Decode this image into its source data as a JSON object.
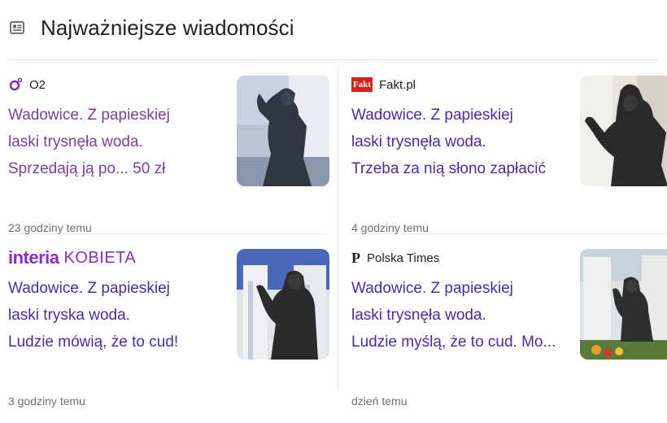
{
  "header": {
    "title": "Najważniejsze wiadomości",
    "icon": "news-icon"
  },
  "colors": {
    "title_link": "#4b2aa8",
    "title_visited": "#7a3fa0",
    "time": "#6f6f6f",
    "interia": "#8a2fc4",
    "fakt": "#d9211c"
  },
  "cards": [
    {
      "source": "O2",
      "source_icon": "o2-logo-icon",
      "title_lines": [
        "Wadowice. Z papieskiej",
        "laski trysnęła woda.",
        "Sprzedają ją po... 50 zł"
      ],
      "time": "23 godziny temu",
      "thumbnail": "pope-statue-photo"
    },
    {
      "source": "Fakt.pl",
      "source_icon": "fakt-logo-icon",
      "source_badge": "Fakt",
      "title_lines": [
        "Wadowice. Z papieskiej",
        "laski trysnęła woda.",
        "Trzeba za nią słono zapłacić"
      ],
      "time": "4 godziny temu",
      "thumbnail": "pope-statue-photo"
    },
    {
      "source_brand": "interia",
      "source_sub": "KOBIETA",
      "source_icon": "interia-logo-icon",
      "title_lines": [
        "Wadowice. Z papieskiej",
        "laski tryska woda.",
        "Ludzie mówią, że to cud!"
      ],
      "time": "3 godziny temu",
      "thumbnail": "pope-statue-photo"
    },
    {
      "source": "Polska Times",
      "source_icon": "polska-times-logo-icon",
      "source_glyph": "P",
      "title_lines": [
        "Wadowice. Z papieskiej",
        "laski trysnęła woda.",
        "Ludzie myślą, że to cud. Mo..."
      ],
      "time": "dzień temu",
      "thumbnail": "pope-statue-photo"
    }
  ]
}
